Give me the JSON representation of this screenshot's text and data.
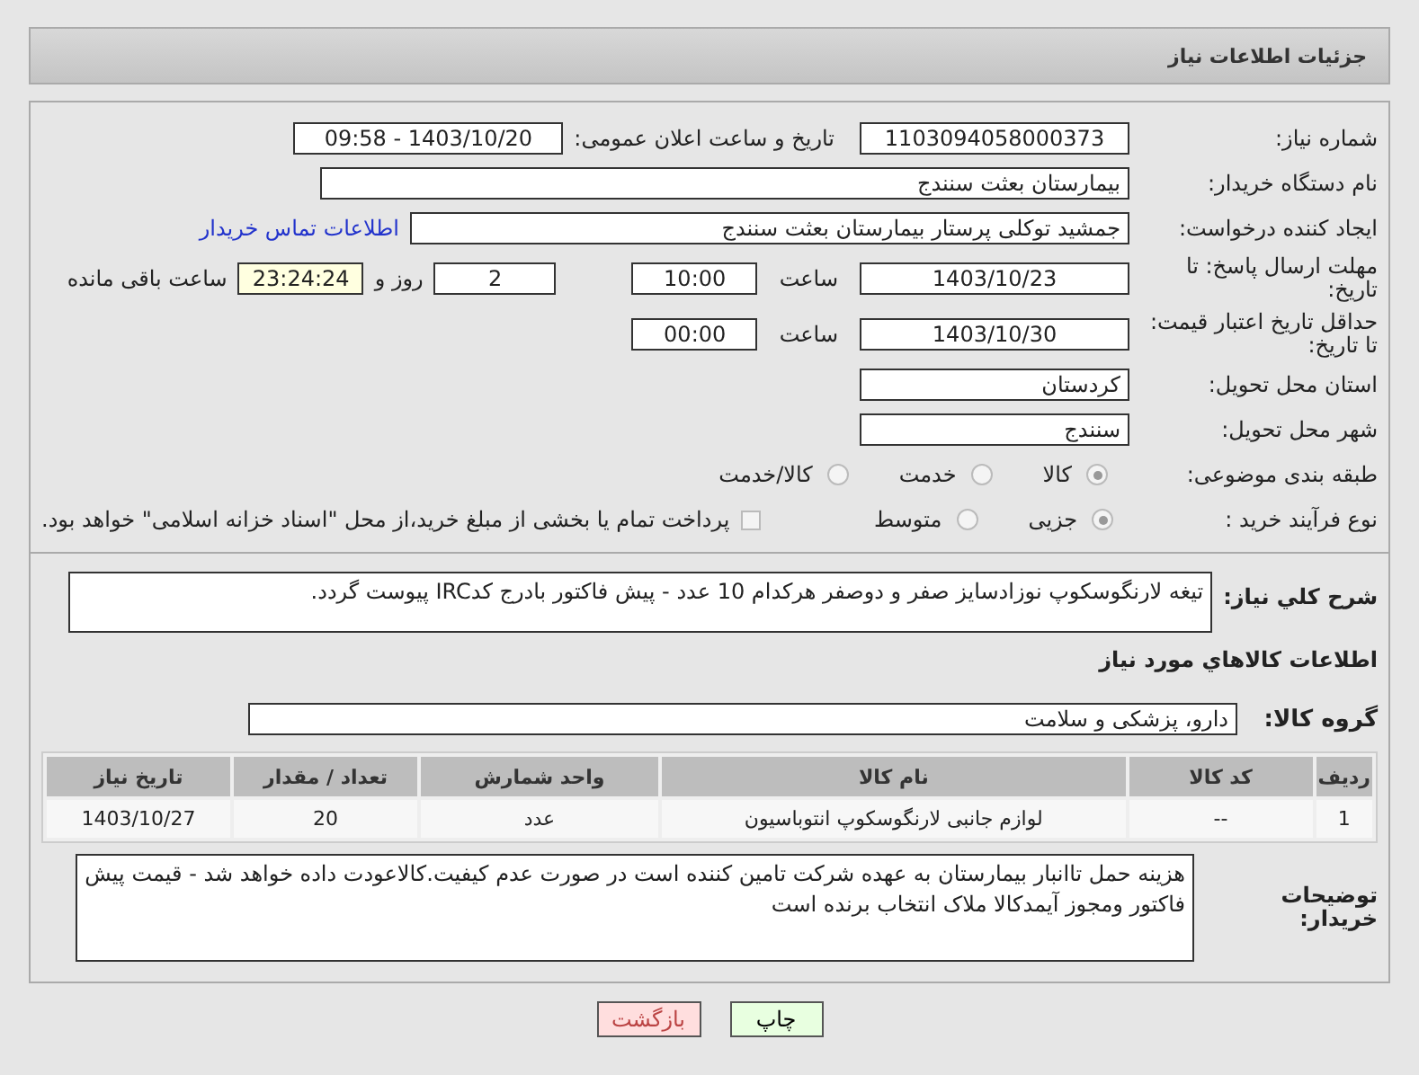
{
  "header": {
    "title": "جزئیات اطلاعات نیاز"
  },
  "fields": {
    "need_number": {
      "label": "شماره نیاز:",
      "value": "1103094058000373"
    },
    "announce": {
      "label": "تاریخ و ساعت اعلان عمومی:",
      "value": "1403/10/20 - 09:58"
    },
    "buyer": {
      "label": "نام دستگاه خریدار:",
      "value": "بیمارستان بعثت سنندج"
    },
    "requester": {
      "label": "ایجاد کننده درخواست:",
      "value": "جمشید  توکلی پرستار بیمارستان بعثت سنندج",
      "link": "اطلاعات تماس خریدار"
    },
    "deadline": {
      "label": "مهلت ارسال پاسخ: تا تاریخ:",
      "date": "1403/10/23",
      "time_label": "ساعت",
      "time": "10:00",
      "days": "2",
      "days_label": "روز و",
      "remaining": "23:24:24",
      "remaining_label": "ساعت باقی مانده"
    },
    "validity": {
      "label": "حداقل تاریخ اعتبار قیمت: تا تاریخ:",
      "date": "1403/10/30",
      "time_label": "ساعت",
      "time": "00:00"
    },
    "province": {
      "label": "استان محل تحویل:",
      "value": "کردستان"
    },
    "city": {
      "label": "شهر محل تحویل:",
      "value": "سنندج"
    }
  },
  "category": {
    "label": "طبقه بندی موضوعی:",
    "options": [
      {
        "label": "کالا",
        "selected": true
      },
      {
        "label": "خدمت",
        "selected": false
      },
      {
        "label": "کالا/خدمت",
        "selected": false
      }
    ]
  },
  "process": {
    "label": "نوع فرآیند خرید :",
    "options": [
      {
        "label": "جزیی",
        "selected": true
      },
      {
        "label": "متوسط",
        "selected": false
      }
    ],
    "treasury": {
      "checked": false,
      "text": "پرداخت تمام یا بخشی از مبلغ خرید،از محل \"اسناد خزانه اسلامی\" خواهد بود."
    }
  },
  "description": {
    "label": "شرح کلي نياز:",
    "value": "تیغه لارنگوسکوپ نوزادسایز صفر و دوصفر هرکدام 10 عدد - پیش فاکتور بادرج کدIRC پیوست گردد."
  },
  "goods_section": {
    "title": "اطلاعات کالاهاي مورد نياز"
  },
  "goods_group": {
    "label": "گروه کالا:",
    "value": "دارو، پزشکی و سلامت"
  },
  "table": {
    "columns": [
      "ردیف",
      "کد کالا",
      "نام کالا",
      "واحد شمارش",
      "تعداد / مقدار",
      "تاریخ نیاز"
    ],
    "rows": [
      [
        "1",
        "--",
        "لوازم جانبی لارنگوسکوپ انتوباسیون",
        "عدد",
        "20",
        "1403/10/27"
      ]
    ]
  },
  "buyer_notes": {
    "label": "توضیحات خریدار:",
    "value": "هزینه حمل تاانبار بیمارستان به عهده شرکت تامین کننده است در صورت عدم کیفیت.کالاعودت داده خواهد شد - قیمت پیش فاکتور ومجوز آیمدکالا ملاک انتخاب برنده است"
  },
  "buttons": [
    {
      "label": "چاپ",
      "kind": "print"
    },
    {
      "label": "بازگشت",
      "kind": "back"
    }
  ]
}
